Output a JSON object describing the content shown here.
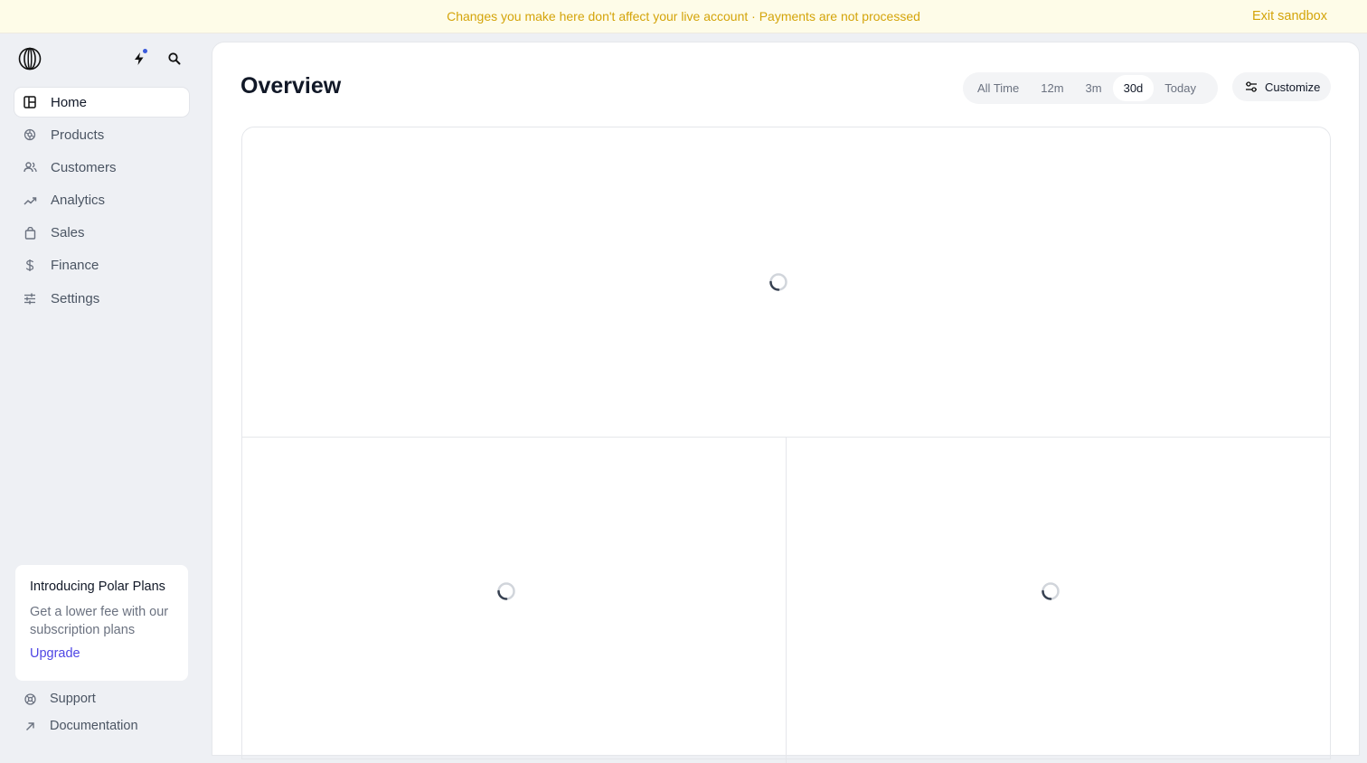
{
  "banner": {
    "message": "Changes you make here don't affect your live account · Payments are not processed",
    "exit_label": "Exit sandbox",
    "color": "#d4a40a"
  },
  "sidebar": {
    "logo_icon": "polar-logo-icon",
    "top_icons": [
      "bolt-icon",
      "search-icon"
    ],
    "items": [
      {
        "label": "Home",
        "icon": "home-icon",
        "active": true
      },
      {
        "label": "Products",
        "icon": "products-icon",
        "active": false
      },
      {
        "label": "Customers",
        "icon": "customers-icon",
        "active": false
      },
      {
        "label": "Analytics",
        "icon": "analytics-icon",
        "active": false
      },
      {
        "label": "Sales",
        "icon": "bag-icon",
        "active": false
      },
      {
        "label": "Finance",
        "icon": "dollar-icon",
        "active": false
      },
      {
        "label": "Settings",
        "icon": "sliders-icon",
        "active": false
      }
    ],
    "promo": {
      "title": "Introducing Polar Plans",
      "text": "Get a lower fee with our subscription plans",
      "link": "Upgrade"
    },
    "footer": [
      {
        "label": "Support",
        "icon": "support-icon"
      },
      {
        "label": "Documentation",
        "icon": "arrow-up-right-icon"
      }
    ]
  },
  "main": {
    "title": "Overview",
    "ranges": [
      "All Time",
      "12m",
      "3m",
      "30d",
      "Today"
    ],
    "selected_range": "30d",
    "customize_label": "Customize",
    "accent": "#4f46e5"
  }
}
